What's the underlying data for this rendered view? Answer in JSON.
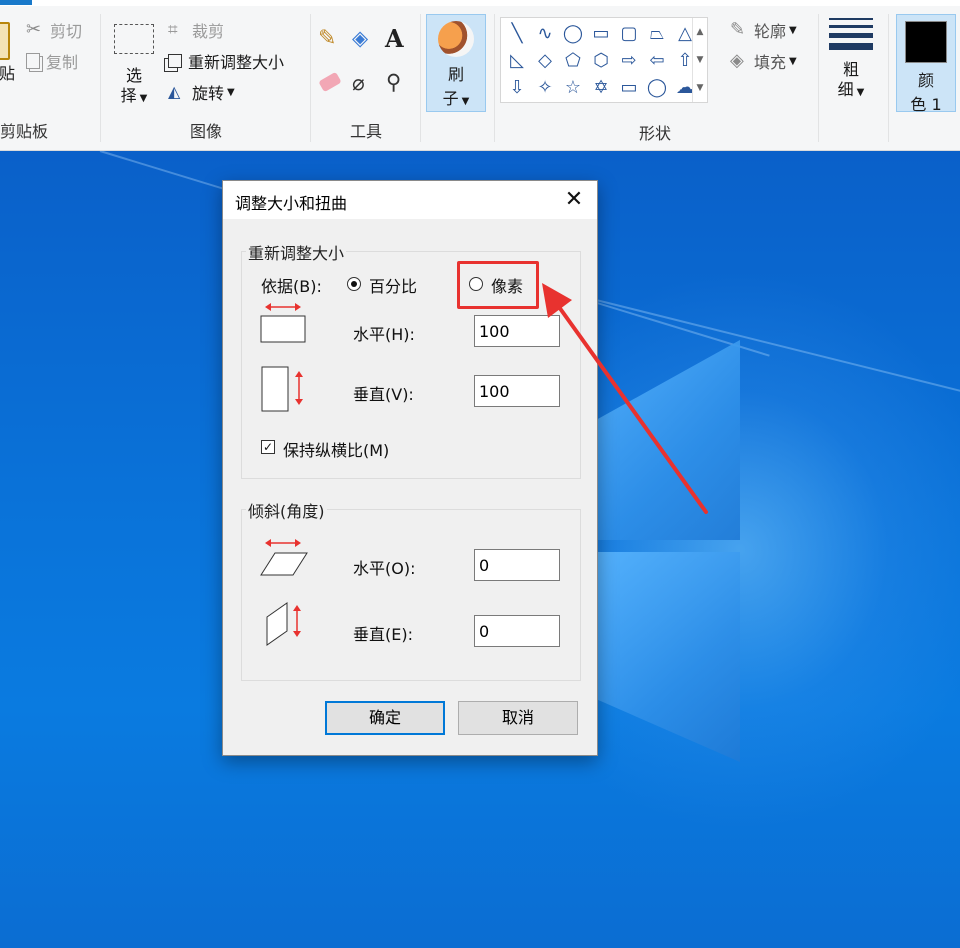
{
  "ribbon": {
    "clipboard": {
      "paste_partial": "贴",
      "cut": "剪切",
      "copy": "复制",
      "group_label": "剪贴板"
    },
    "image": {
      "select_line1": "选",
      "select_line2": "择",
      "crop": "裁剪",
      "resize": "重新调整大小",
      "rotate": "旋转",
      "group_label": "图像"
    },
    "tools": {
      "group_label": "工具"
    },
    "brush": {
      "line1": "刷",
      "line2": "子"
    },
    "shapes": {
      "outline": "轮廓",
      "fill": "填充",
      "group_label": "形状"
    },
    "size": {
      "line1": "粗",
      "line2": "细"
    },
    "color1": {
      "line1": "颜",
      "line2": "色 1",
      "swatch_color": "#000000"
    }
  },
  "dialog": {
    "title": "调整大小和扭曲",
    "close_icon": "close-icon",
    "resize": {
      "legend": "重新调整大小",
      "by_label": "依据(B):",
      "percent_label": "百分比",
      "pixels_label": "像素",
      "selected": "percent",
      "horizontal_label": "水平(H):",
      "horizontal_value": "100",
      "vertical_label": "垂直(V):",
      "vertical_value": "100",
      "keep_ratio_label": "保持纵横比(M)",
      "keep_ratio_checked": true
    },
    "skew": {
      "legend": "倾斜(角度)",
      "horizontal_label": "水平(O):",
      "horizontal_value": "0",
      "vertical_label": "垂直(E):",
      "vertical_value": "0"
    },
    "ok_label": "确定",
    "cancel_label": "取消"
  },
  "annotation": {
    "color": "#e8322f"
  }
}
